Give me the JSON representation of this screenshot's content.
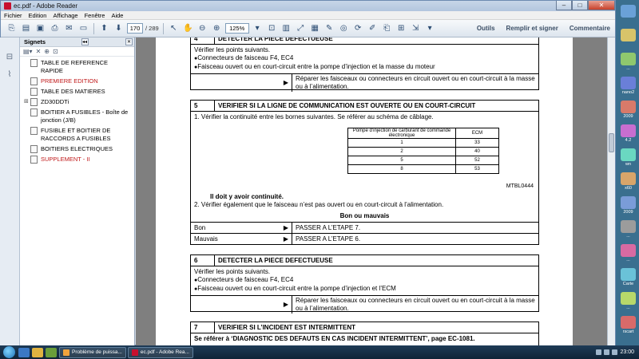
{
  "window": {
    "title": "ec.pdf - Adobe Reader",
    "minimize": "‒",
    "maximize": "□",
    "close": "✕"
  },
  "menu": [
    "Fichier",
    "Edition",
    "Affichage",
    "Fenêtre",
    "Aide"
  ],
  "toolbar": {
    "page_current": "170",
    "page_total": "/ 289",
    "zoom": "125%",
    "tools_label": "Outils",
    "fill_sign_label": "Remplir et signer",
    "comment_label": "Commentaire"
  },
  "bookmarks": {
    "title": "Signets",
    "items": [
      {
        "label": "TABLE DE REFERENCE RAPIDE",
        "red": false,
        "expander": ""
      },
      {
        "label": "PREMIERE EDITION",
        "red": true,
        "expander": ""
      },
      {
        "label": "TABLE DES MATIERES",
        "red": false,
        "expander": ""
      },
      {
        "label": "ZD30DDTi",
        "red": false,
        "expander": "⊞"
      },
      {
        "label": "BOITIER A FUSIBLES - Boîte de jonction (J/B)",
        "red": false,
        "expander": ""
      },
      {
        "label": "FUSIBLE ET BOITIER DE RACCORDS A FUSIBLES",
        "red": false,
        "expander": ""
      },
      {
        "label": "BOITIERS ELECTRIQUES",
        "red": false,
        "expander": ""
      },
      {
        "label": "SUPPLEMENT - II",
        "red": true,
        "expander": ""
      }
    ]
  },
  "doc": {
    "step4": {
      "num": "4",
      "title": "DETECTER LA PIECE DEFECTUEUSE",
      "line1": "Vérifier les points suivants.",
      "bullet1": "Connecteurs de faisceau F4, EC4",
      "bullet2": "Faisceau ouvert ou en court-circuit entre la pompe d’injection et la masse du moteur",
      "arrow": "▶",
      "action": "Réparer les faisceaux ou connecteurs en circuit ouvert ou en court-circuit à la masse ou à l’alimentation."
    },
    "step5": {
      "num": "5",
      "title": "VERIFIER SI LA LIGNE DE COMMUNICATION EST OUVERTE OU EN COURT-CIRCUIT",
      "line1": "1. Vérifier la continuité entre les bornes suivantes. Se référer au schéma de câblage.",
      "table_header_left": "Pompe d’injection de carburant de commande électronique",
      "table_header_right": "ECM",
      "table_rows": [
        {
          "left": "1",
          "right": "33"
        },
        {
          "left": "2",
          "right": "40"
        },
        {
          "left": "5",
          "right": "52"
        },
        {
          "left": "8",
          "right": "53"
        }
      ],
      "ref_code": "MTBL0444",
      "continuity": "Il doit y avoir continuité.",
      "line2": "2. Vérifier également que le faisceau n’est pas ouvert ou en court-circuit à l’alimentation.",
      "verdict_title": "Bon ou mauvais",
      "rows": [
        {
          "label": "Bon",
          "arrow": "▶",
          "value": "PASSER A L’ETAPE 7."
        },
        {
          "label": "Mauvais",
          "arrow": "▶",
          "value": "PASSER A L’ETAPE 6."
        }
      ]
    },
    "step6": {
      "num": "6",
      "title": "DETECTER LA PIECE DEFECTUEUSE",
      "line1": "Vérifier les points suivants.",
      "bullet1": "Connecteurs de faisceau F4, EC4",
      "bullet2": "Faisceau ouvert ou en court-circuit entre la pompe d’injection et l’ECM",
      "arrow": "▶",
      "action": "Réparer les faisceaux ou connecteurs en circuit ouvert ou en court-circuit à la masse ou à l’alimentation."
    },
    "step7": {
      "num": "7",
      "title": "VERIFIER SI L’INCIDENT EST INTERMITTENT",
      "line1": "Se référer à ‘DIAGNOSTIC DES DEFAUTS EN CAS INCIDENT INTERMITTENT’, page EC-1081."
    }
  },
  "desktop": {
    "icons": [
      {
        "label": "",
        "color": "#6aa1d8"
      },
      {
        "label": "",
        "color": "#d8c46a"
      },
      {
        "label": "...",
        "color": "#8fc86e"
      },
      {
        "label": "nano2",
        "color": "#6a7fd8"
      },
      {
        "label": "2009",
        "color": "#d87a6a"
      },
      {
        "label": "4.2",
        "color": "#c86ed0"
      },
      {
        "label": "wn",
        "color": "#6ad8c1"
      },
      {
        "label": "x60",
        "color": "#d8a56a"
      },
      {
        "label": "2009",
        "color": "#7a9cd8"
      },
      {
        "label": "...",
        "color": "#9c9c9c"
      },
      {
        "label": "...",
        "color": "#d86aa2"
      },
      {
        "label": "Carte",
        "color": "#6ac2d8"
      },
      {
        "label": "...",
        "color": "#b8d86a"
      },
      {
        "label": "rscart",
        "color": "#d86a6a"
      }
    ]
  },
  "taskbar": {
    "tasks": [
      {
        "label": "Problème de puissa...",
        "color": "#f1a33c"
      },
      {
        "label": "ec.pdf - Adobe Rea...",
        "color": "#c8102e"
      }
    ],
    "clock": "23:00"
  }
}
